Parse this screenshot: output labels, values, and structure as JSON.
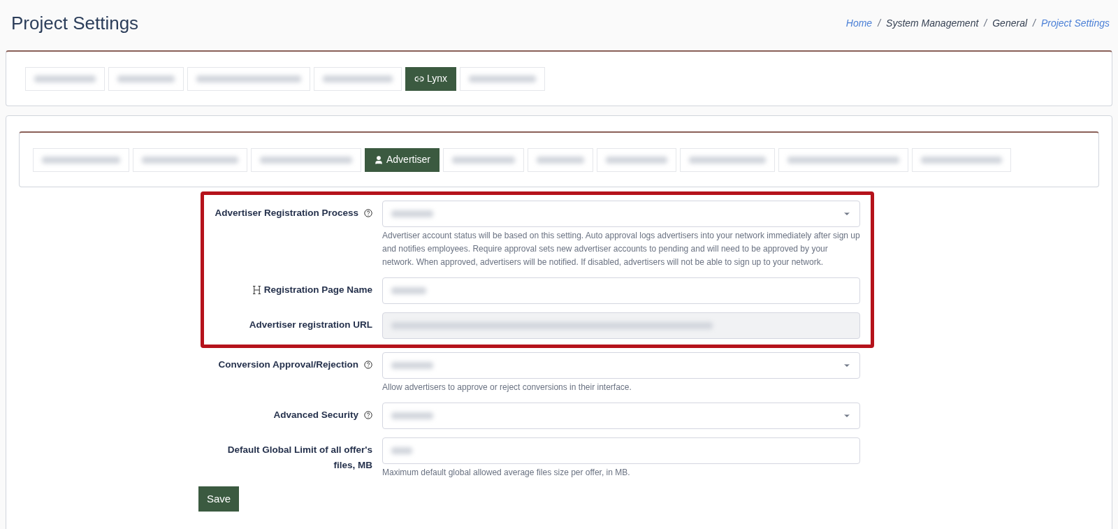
{
  "page_title": "Project Settings",
  "breadcrumb_separator": "/",
  "breadcrumb": [
    {
      "label": "Home",
      "link": true
    },
    {
      "label": "System Management",
      "link": false
    },
    {
      "label": "General",
      "link": false
    },
    {
      "label": "Project Settings",
      "link": true
    }
  ],
  "main_tabs": [
    {
      "redacted": true,
      "selected": false
    },
    {
      "redacted": true,
      "selected": false
    },
    {
      "redacted": true,
      "selected": false
    },
    {
      "redacted": true,
      "selected": false
    },
    {
      "label": "Lynx",
      "redacted": false,
      "selected": true
    },
    {
      "redacted": true,
      "selected": false
    }
  ],
  "sub_tabs": [
    {
      "redacted": true,
      "selected": false
    },
    {
      "redacted": true,
      "selected": false
    },
    {
      "redacted": true,
      "selected": false
    },
    {
      "label": "Advertiser",
      "redacted": false,
      "selected": true
    },
    {
      "redacted": true,
      "selected": false
    },
    {
      "redacted": true,
      "selected": false
    },
    {
      "redacted": true,
      "selected": false
    },
    {
      "redacted": true,
      "selected": false
    },
    {
      "redacted": true,
      "selected": false
    },
    {
      "redacted": true,
      "selected": false
    }
  ],
  "fields": [
    {
      "kind": "select",
      "label": "Advertiser Registration Process",
      "help_icon": true,
      "heading_icon": false,
      "highlighted": true,
      "disabled": false,
      "value_redacted": true,
      "help": "Advertiser account status will be based on this setting. Auto approval logs advertisers into your network immediately after sign up and notifies employees. Require approval sets new advertiser accounts to pending and will need to be approved by your network. When approved, advertisers will be notified. If disabled, advertisers will not be able to sign up to your network."
    },
    {
      "kind": "text",
      "label": "Registration Page Name",
      "help_icon": false,
      "heading_icon": true,
      "highlighted": true,
      "disabled": false,
      "value_redacted": true
    },
    {
      "kind": "text",
      "label": "Advertiser registration URL",
      "help_icon": false,
      "heading_icon": false,
      "highlighted": true,
      "disabled": true,
      "value_redacted": true
    },
    {
      "kind": "select",
      "label": "Conversion Approval/Rejection",
      "help_icon": true,
      "heading_icon": false,
      "highlighted": false,
      "disabled": false,
      "value_redacted": true,
      "help": "Allow advertisers to approve or reject conversions in their interface."
    },
    {
      "kind": "select",
      "label": "Advanced Security",
      "help_icon": true,
      "heading_icon": false,
      "highlighted": false,
      "disabled": false,
      "value_redacted": true
    },
    {
      "kind": "text",
      "label": "Default Global Limit of all offer's files, MB",
      "help_icon": false,
      "heading_icon": false,
      "highlighted": false,
      "disabled": false,
      "value_redacted": true,
      "help": "Maximum default global allowed average files size per offer, in MB."
    }
  ],
  "save_button": "Save"
}
